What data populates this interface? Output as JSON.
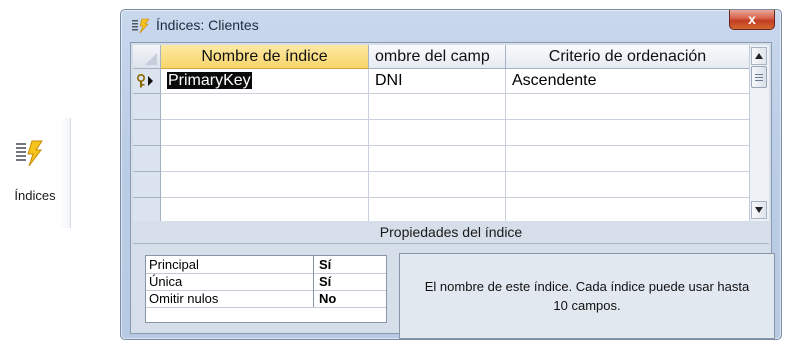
{
  "ribbon": {
    "button_label": "Índices",
    "icon": "indexes-lightning-icon"
  },
  "window": {
    "title": "Índices: Clientes",
    "close_glyph": "x",
    "icon": "indexes-lightning-icon"
  },
  "grid": {
    "columns": [
      "Nombre de índice",
      "ombre del camp",
      "Criterio de ordenación"
    ],
    "rows": [
      {
        "index_name": "PrimaryKey",
        "field_name": "DNI",
        "sort_order": "Ascendente",
        "selector_icon": "key-arrow-icon"
      },
      {
        "index_name": "",
        "field_name": "",
        "sort_order": ""
      },
      {
        "index_name": "",
        "field_name": "",
        "sort_order": ""
      },
      {
        "index_name": "",
        "field_name": "",
        "sort_order": ""
      },
      {
        "index_name": "",
        "field_name": "",
        "sort_order": ""
      }
    ]
  },
  "properties": {
    "title": "Propiedades del índice",
    "items": [
      {
        "name": "Principal",
        "value": "Sí"
      },
      {
        "name": "Única",
        "value": "Sí"
      },
      {
        "name": "Omitir nulos",
        "value": "No"
      }
    ],
    "help_text": "El nombre de este índice. Cada índice puede usar hasta 10 campos."
  },
  "colors": {
    "active_header": "#f8d56a",
    "window_frame": "#bccde6",
    "close_button": "#c13c22"
  }
}
